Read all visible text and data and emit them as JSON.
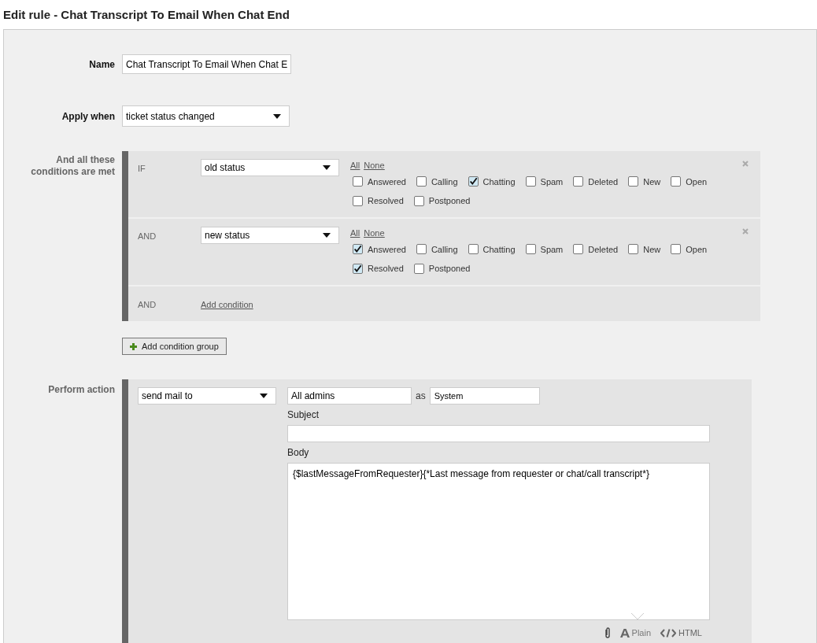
{
  "title": "Edit rule - Chat Transcript To Email When Chat End",
  "name": {
    "label": "Name",
    "value": "Chat Transcript To Email When Chat E"
  },
  "apply_when": {
    "label": "Apply when",
    "value": "ticket status changed"
  },
  "conditions": {
    "label": "And all these conditions are met",
    "rows": [
      {
        "connector": "IF",
        "kind": "status",
        "field": "old status",
        "all": "All",
        "none": "None",
        "options": [
          {
            "label": "Answered",
            "checked": false
          },
          {
            "label": "Calling",
            "checked": false
          },
          {
            "label": "Chatting",
            "checked": true
          },
          {
            "label": "Spam",
            "checked": false
          },
          {
            "label": "Deleted",
            "checked": false
          },
          {
            "label": "New",
            "checked": false
          },
          {
            "label": "Open",
            "checked": false
          },
          {
            "label": "Resolved",
            "checked": false
          },
          {
            "label": "Postponed",
            "checked": false
          }
        ]
      },
      {
        "connector": "AND",
        "kind": "status",
        "field": "new status",
        "all": "All",
        "none": "None",
        "options": [
          {
            "label": "Answered",
            "checked": true
          },
          {
            "label": "Calling",
            "checked": false
          },
          {
            "label": "Chatting",
            "checked": false
          },
          {
            "label": "Spam",
            "checked": false
          },
          {
            "label": "Deleted",
            "checked": false
          },
          {
            "label": "New",
            "checked": false
          },
          {
            "label": "Open",
            "checked": false
          },
          {
            "label": "Resolved",
            "checked": true
          },
          {
            "label": "Postponed",
            "checked": false
          }
        ]
      },
      {
        "connector": "AND",
        "kind": "add",
        "link": "Add condition"
      }
    ]
  },
  "add_group_button": "Add condition group",
  "action": {
    "label": "Perform action",
    "type": "send mail to",
    "recipient": "All admins",
    "as": "as",
    "sender": "System",
    "subject_label": "Subject",
    "body_label": "Body",
    "body": "{$lastMessageFromRequester}{*Last message from requester or chat/call transcript*}",
    "formats": [
      {
        "label": "Plain",
        "selected": true
      },
      {
        "label": "HTML",
        "selected": false
      }
    ]
  }
}
